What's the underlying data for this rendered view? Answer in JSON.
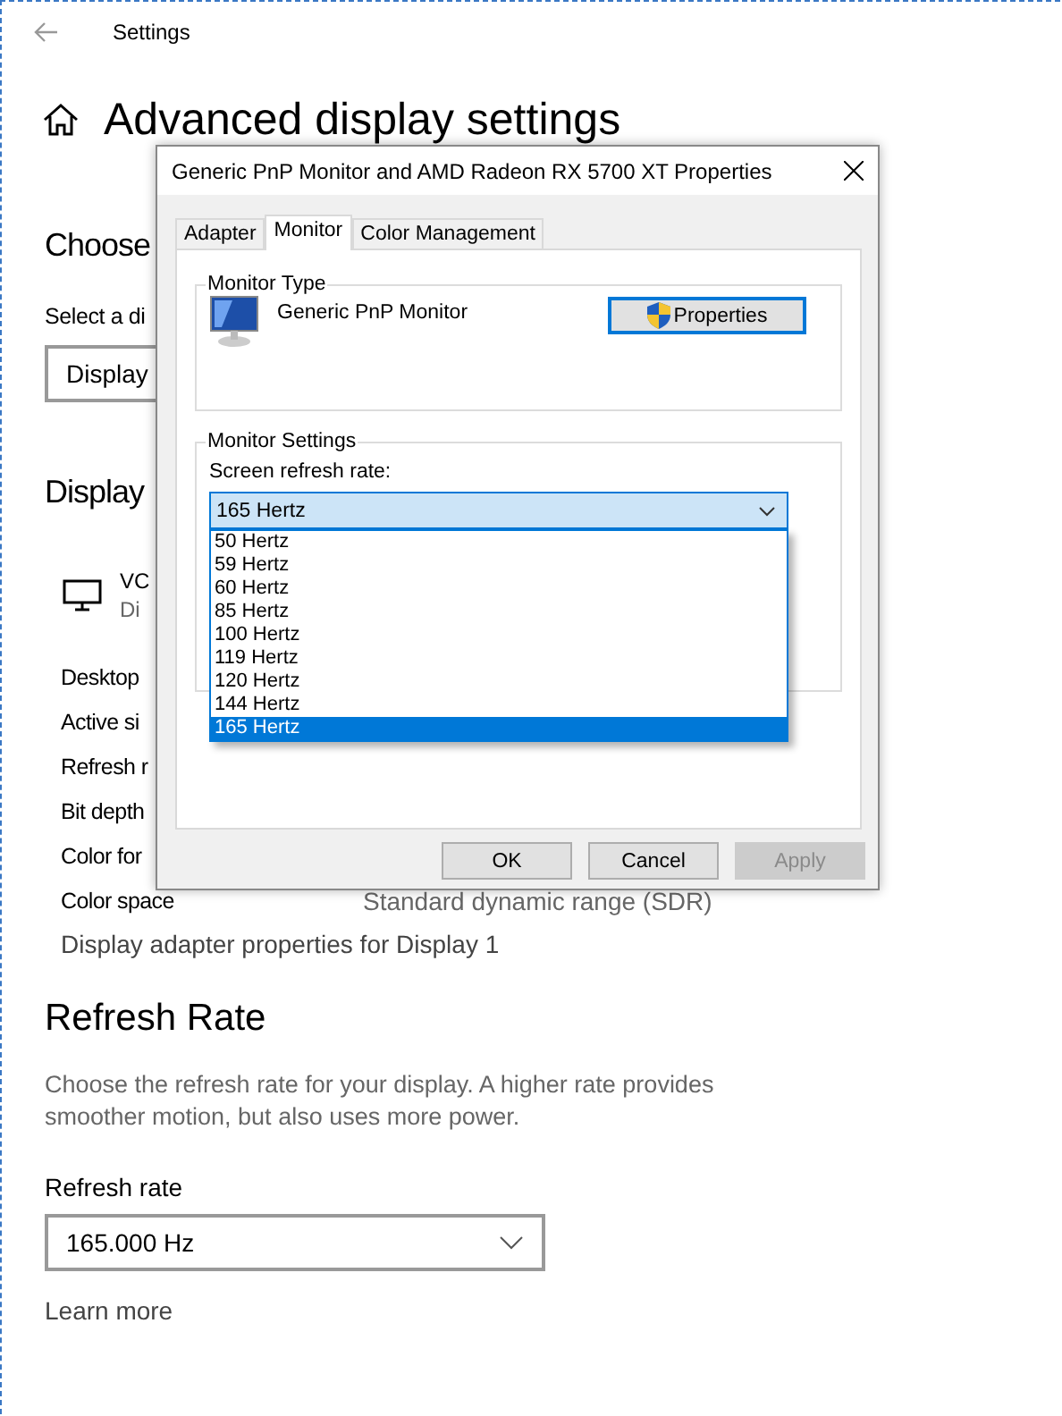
{
  "window": {
    "title": "Settings"
  },
  "page": {
    "title": "Advanced display settings",
    "choose": {
      "heading": "Choose",
      "label": "Select a di",
      "dropdown_value": "Display "
    },
    "display_info": {
      "heading": "Display",
      "device_name": "VC",
      "device_sub": "Di",
      "rows": [
        {
          "label": "Desktop"
        },
        {
          "label": "Active si"
        },
        {
          "label": "Refresh r"
        },
        {
          "label": "Bit depth"
        },
        {
          "label": "Color for"
        },
        {
          "label": "Color space",
          "value": "Standard dynamic range (SDR)"
        }
      ],
      "link": "Display adapter properties for Display 1"
    },
    "refresh": {
      "heading": "Refresh Rate",
      "description": "Choose the refresh rate for your display. A higher rate provides smoother motion, but also uses more power.",
      "label": "Refresh rate",
      "value": "165.000 Hz",
      "link": "Learn more"
    }
  },
  "dialog": {
    "title": "Generic PnP Monitor and AMD Radeon RX 5700 XT Properties",
    "tabs": [
      {
        "label": "Adapter",
        "selected": false
      },
      {
        "label": "Monitor",
        "selected": true
      },
      {
        "label": "Color Management",
        "selected": false
      }
    ],
    "monitor_type": {
      "legend": "Monitor Type",
      "name": "Generic PnP Monitor",
      "button": "Properties"
    },
    "monitor_settings": {
      "legend": "Monitor Settings",
      "label": "Screen refresh rate:",
      "value": "165 Hertz",
      "options": [
        {
          "label": "50 Hertz",
          "selected": false
        },
        {
          "label": "59 Hertz",
          "selected": false
        },
        {
          "label": "60 Hertz",
          "selected": false
        },
        {
          "label": "85 Hertz",
          "selected": false
        },
        {
          "label": "100 Hertz",
          "selected": false
        },
        {
          "label": "119 Hertz",
          "selected": false
        },
        {
          "label": "120 Hertz",
          "selected": false
        },
        {
          "label": "144 Hertz",
          "selected": false
        },
        {
          "label": "165 Hertz",
          "selected": true
        }
      ]
    },
    "buttons": [
      {
        "label": "OK",
        "disabled": false
      },
      {
        "label": "Cancel",
        "disabled": false
      },
      {
        "label": "Apply",
        "disabled": true
      }
    ]
  }
}
